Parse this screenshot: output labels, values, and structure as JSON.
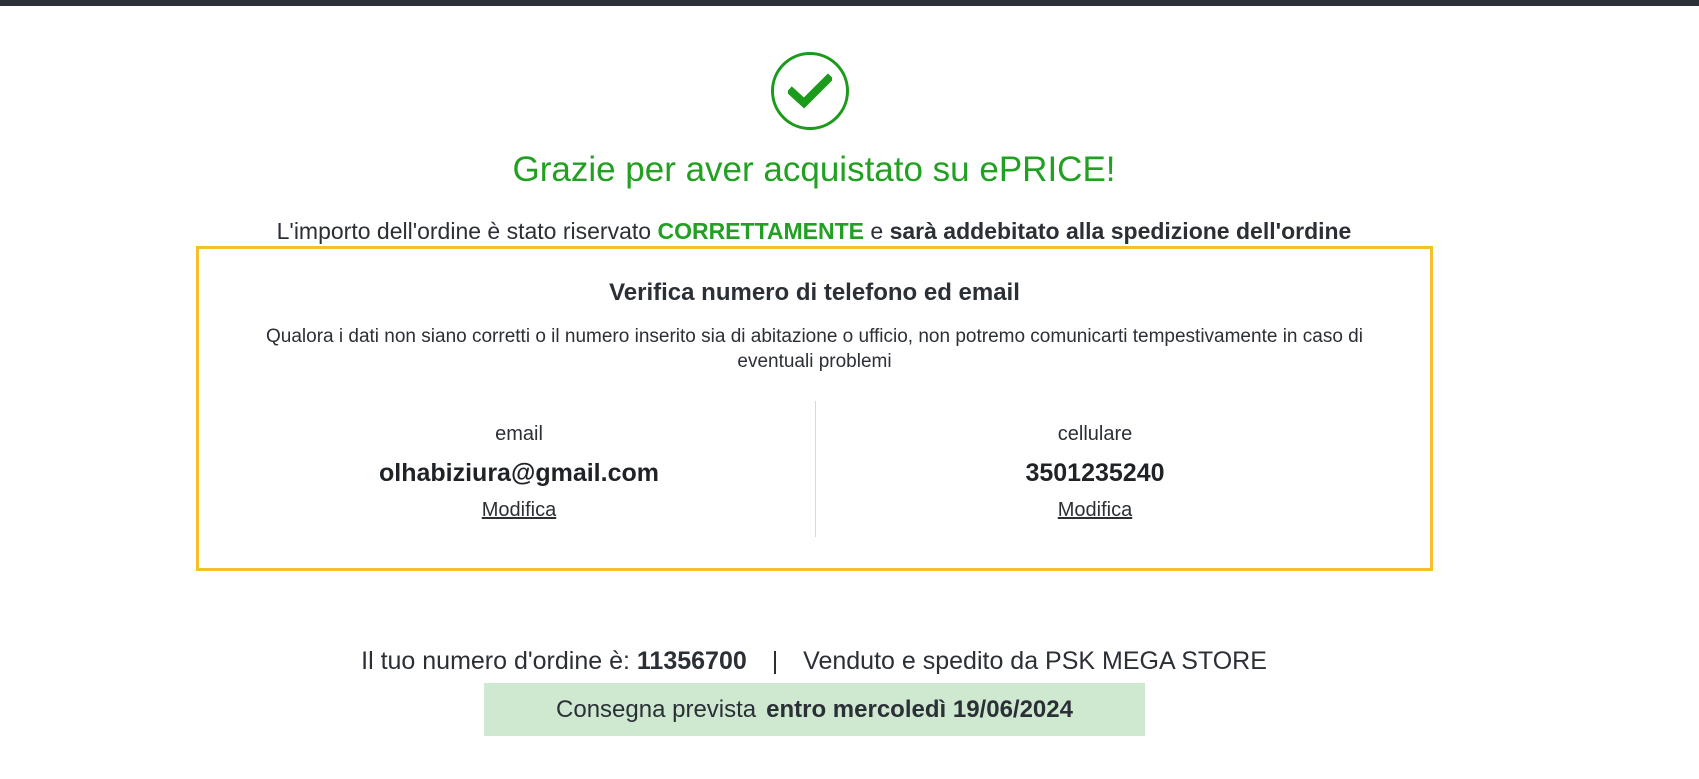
{
  "header": {
    "title": "Grazie per aver acquistato su ePRICE!",
    "reserved_prefix": "L'importo dell'ordine è stato riservato ",
    "reserved_status": "CORRETTAMENTE",
    "reserved_middle": " e ",
    "reserved_suffix": "sarà addebitato alla spedizione dell'ordine",
    "success_icon": "check-icon",
    "colors": {
      "success": "#22a022",
      "box_border": "#f5c02b",
      "delivery_bg": "#cfe9d1"
    }
  },
  "verify": {
    "title": "Verifica numero di telefono ed email",
    "description": "Qualora i dati non siano corretti o il numero inserito sia di abitazione o ufficio, non potremo comunicarti tempestivamente in caso di eventuali problemi",
    "email": {
      "label": "email",
      "value": "olhabiziura@gmail.com",
      "edit_label": "Modifica"
    },
    "phone": {
      "label": "cellulare",
      "value": "3501235240",
      "edit_label": "Modifica"
    }
  },
  "order": {
    "number_label": "Il tuo numero d'ordine è:",
    "number": "11356700",
    "separator": "|",
    "seller": "Venduto e spedito da PSK MEGA STORE",
    "delivery_label": "Consegna prevista",
    "delivery_date": "entro mercoledì 19/06/2024"
  }
}
